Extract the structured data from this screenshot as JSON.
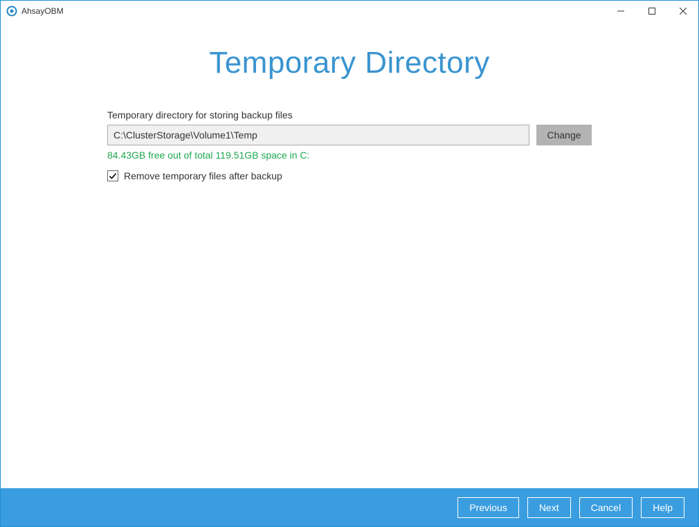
{
  "window": {
    "title": "AhsayOBM"
  },
  "page": {
    "heading": "Temporary Directory",
    "field_label": "Temporary directory for storing backup files",
    "path_value": "C:\\ClusterStorage\\Volume1\\Temp",
    "change_label": "Change",
    "free_space_text": "84.43GB free out of total 119.51GB space in C:",
    "remove_temp_label": "Remove temporary files after backup",
    "remove_temp_checked": true
  },
  "footer": {
    "previous": "Previous",
    "next": "Next",
    "cancel": "Cancel",
    "help": "Help"
  }
}
